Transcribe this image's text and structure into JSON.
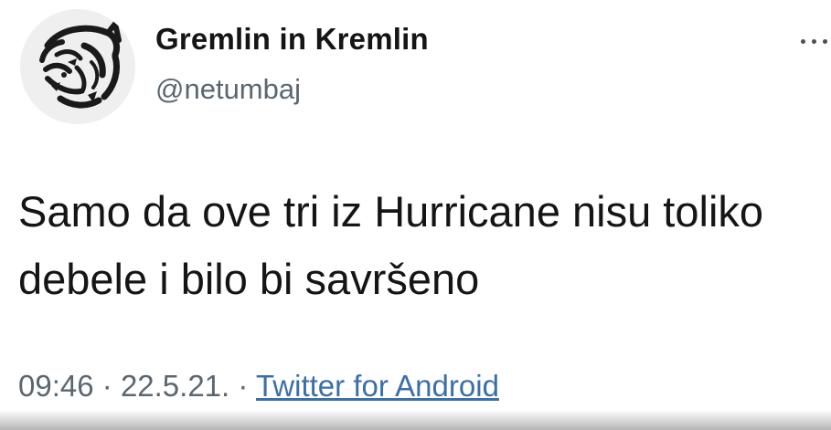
{
  "tweet": {
    "author": {
      "display_name": "Gremlin in Kremlin",
      "handle": "@netumbaj",
      "avatar_icon": "tiger-head-icon"
    },
    "more_icon": "more-horizontal-icon",
    "text_lines": [
      "Samo da ove tri iz Hurricane nisu toliko",
      "debele i bilo bi savršeno"
    ],
    "time": "09:46",
    "separator": "·",
    "date": "22.5.21.",
    "source": "Twitter for Android"
  },
  "colors": {
    "text": "#151515",
    "secondary_text": "#5b6670",
    "link": "#3a6fa8",
    "background": "#ffffff"
  }
}
